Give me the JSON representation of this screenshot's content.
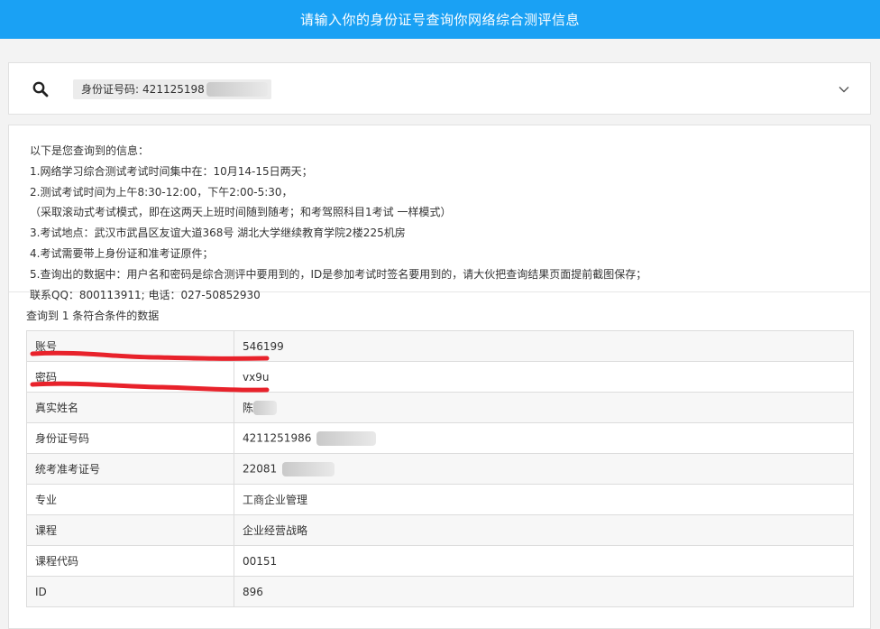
{
  "header": {
    "title": "请输入你的身份证号查询你网络综合测评信息"
  },
  "search": {
    "tag_label": "身份证号码:",
    "tag_value": "421125198"
  },
  "info": {
    "lines": [
      "以下是您查询到的信息：",
      "1.网络学习综合测试考试时间集中在：10月14-15日两天；",
      "2.测试考试时间为上午8:30-12:00，下午2:00-5:30，",
      "（采取滚动式考试模式，即在这两天上班时间随到随考；和考驾照科目1考试 一样模式）",
      "3.考试地点：武汉市武昌区友谊大道368号 湖北大学继续教育学院2楼225机房",
      "4.考试需要带上身份证和准考证原件；",
      "5.查询出的数据中：用户名和密码是综合测评中要用到的，ID是参加考试时签名要用到的，请大伙把查询结果页面提前截图保存；",
      "联系QQ：800113911; 电话：027-50852930"
    ]
  },
  "results": {
    "count_text": "查询到 1 条符合条件的数据",
    "rows": [
      {
        "label": "账号",
        "value": "546199"
      },
      {
        "label": "密码",
        "value": "vx9u"
      },
      {
        "label": "真实姓名",
        "value": "陈"
      },
      {
        "label": "身份证号码",
        "value": "4211251986"
      },
      {
        "label": "统考准考证号",
        "value": "22081"
      },
      {
        "label": "专业",
        "value": "工商企业管理"
      },
      {
        "label": "课程",
        "value": "企业经营战略"
      },
      {
        "label": "课程代码",
        "value": "00151"
      },
      {
        "label": "ID",
        "value": "896"
      }
    ]
  },
  "colors": {
    "header_bg": "#1aa1f4",
    "annotation": "#e8222b"
  }
}
